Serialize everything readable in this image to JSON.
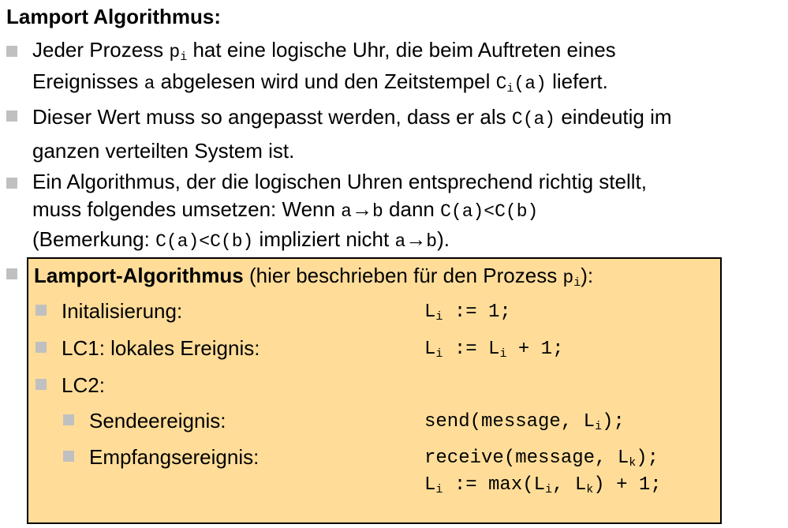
{
  "title": "Lamport Algorithmus:",
  "bullets": [
    {
      "p1": "Jeder Prozess ",
      "p_base": "p",
      "p_sub": "i",
      "p2": " hat eine logische Uhr, die beim Auftreten eines",
      "p3": "Ereignisses ",
      "a": "a",
      "p4": " abgelesen wird und den Zeitstempel ",
      "c_base": "C",
      "c_sub": "i",
      "c_arg": "(a)",
      "p5": " liefert."
    },
    {
      "p1": "Dieser Wert muss so angepasst werden, dass er als ",
      "c": "C(a)",
      "p2": " eindeutig im",
      "p3": "ganzen verteilten System ist."
    },
    {
      "l1": "Ein Algorithmus, der die logischen Uhren entsprechend richtig stellt,",
      "l2a": "muss folgendes umsetzen: Wenn ",
      "a": "a",
      "arrow": "→",
      "b": "b",
      "l2b": " dann ",
      "cond": "C(a)<C(b)",
      "l3a": "(Bemerkung: ",
      "l3b": " impliziert nicht ",
      "l3c": ")."
    }
  ],
  "box": {
    "heading_bold": "Lamport-Algorithmus",
    "heading_rest": " (hier beschrieben für den Prozess ",
    "heading_p": "p",
    "heading_sub": "i",
    "heading_end": "):",
    "items": [
      {
        "label": "Initalisierung:",
        "code_pre": "L",
        "code_sub": "i",
        "code_post": " := 1;"
      },
      {
        "label": "LC1: lokales Ereignis:",
        "code_pre": "L",
        "code_sub": "i",
        "code_mid": " := L",
        "code_sub2": "i",
        "code_post": " + 1;"
      },
      {
        "label": "LC2:"
      }
    ],
    "subitems": [
      {
        "label": "Sendeereignis:",
        "code_pre": "send(message, L",
        "code_sub": "i",
        "code_post": ");"
      },
      {
        "label": "Empfangsereignis:",
        "line1_pre": "receive(message, L",
        "line1_sub": "k",
        "line1_post": ");",
        "line2_pre": "L",
        "line2_sub": "i",
        "line2_mid": " := max(L",
        "line2_sub2": "i",
        "line2_mid2": ", L",
        "line2_sub3": "k",
        "line2_post": ") + 1;"
      }
    ]
  }
}
